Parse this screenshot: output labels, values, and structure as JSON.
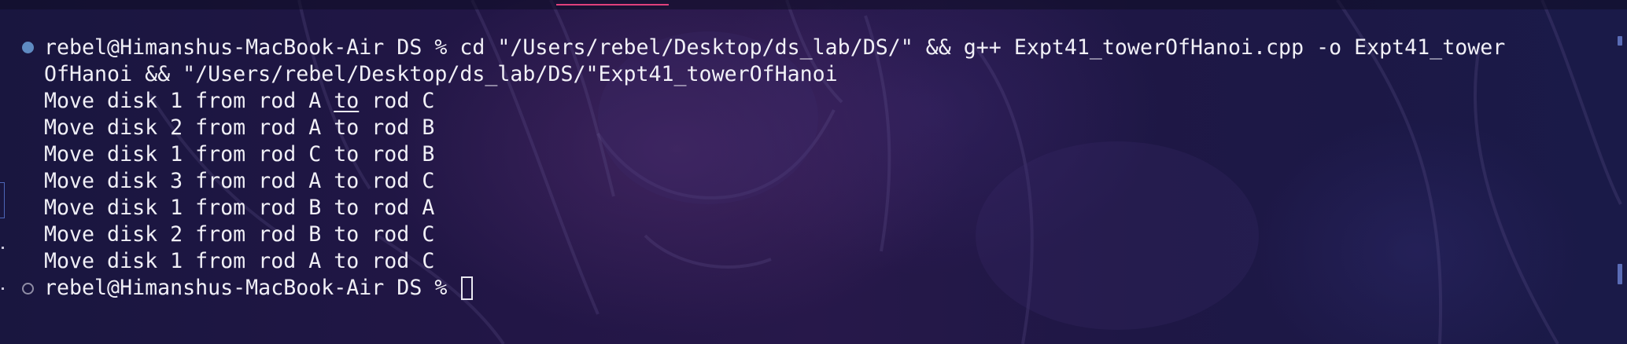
{
  "terminal": {
    "command_line_1": "rebel@Himanshus-MacBook-Air DS % cd \"/Users/rebel/Desktop/ds_lab/DS/\" && g++ Expt41_towerOfHanoi.cpp -o Expt41_tower",
    "command_line_2": "OfHanoi && \"/Users/rebel/Desktop/ds_lab/DS/\"Expt41_towerOfHanoi",
    "output_1_prefix": "Move disk 1 from rod A ",
    "output_1_link": "to",
    "output_1_suffix": " rod C",
    "output_lines": [
      "Move disk 2 from rod A to rod B",
      "Move disk 1 from rod C to rod B",
      "Move disk 3 from rod A to rod C",
      "Move disk 1 from rod B to rod A",
      "Move disk 2 from rod B to rod C",
      "Move disk 1 from rod A to rod C"
    ],
    "prompt": "rebel@Himanshus-MacBook-Air DS % "
  },
  "colors": {
    "text": "#f1f0f7",
    "accent_tab": "#e0407c",
    "prompt_marker_filled": "#5f8bc2",
    "prompt_marker_hollow": "#8f8da5",
    "scrollbar": "#5a6cb6"
  }
}
